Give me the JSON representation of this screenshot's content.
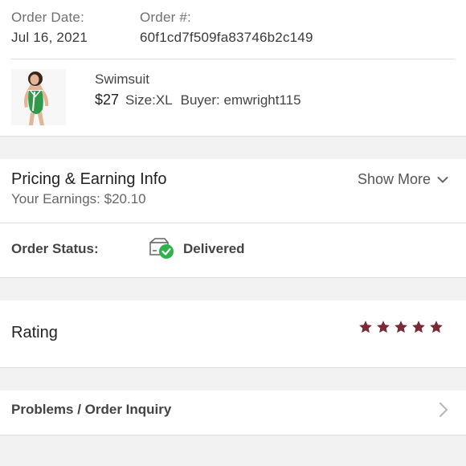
{
  "order": {
    "date_label": "Order Date:",
    "date_value": "Jul 16, 2021",
    "number_label": "Order #:",
    "number_value": "60f1cd7f509fa83746b2c149"
  },
  "item": {
    "title": "Swimsuit",
    "price": "$27",
    "size": "Size:XL",
    "buyer": "Buyer: emwright115"
  },
  "pricing": {
    "title": "Pricing & Earning Info",
    "earnings": "Your Earnings: $20.10",
    "show_more": "Show More"
  },
  "status": {
    "label": "Order Status:",
    "value": "Delivered",
    "icon": "package-delivered-icon"
  },
  "rating": {
    "label": "Rating",
    "stars": 5,
    "max_stars": 5,
    "star_color": "#7a2a36"
  },
  "problems": {
    "label": "Problems / Order Inquiry"
  },
  "colors": {
    "delivered_check": "#2eb34a",
    "background": "#f2f2f2"
  }
}
